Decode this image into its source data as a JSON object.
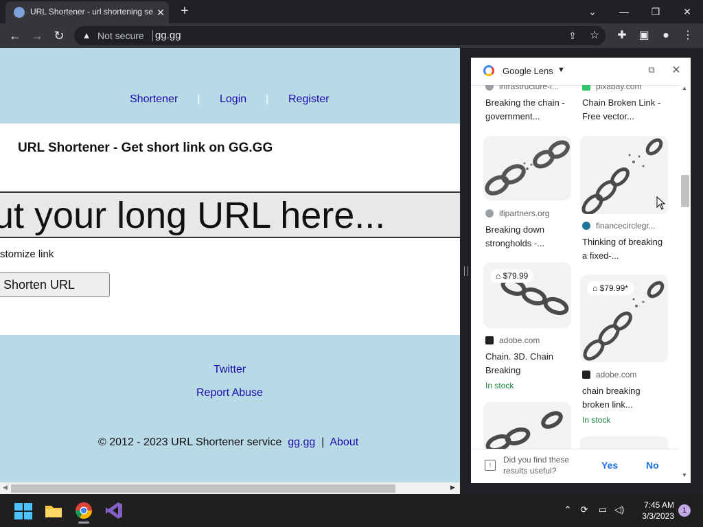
{
  "browser": {
    "tab_title": "URL Shortener - url shortening se",
    "new_tab": "+",
    "window_buttons": {
      "tab_search": "⌄",
      "minimize": "—",
      "restore": "❐",
      "close": "✕"
    },
    "security_label": "Not secure",
    "url": "gg.gg"
  },
  "page": {
    "nav": {
      "shortener": "Shortener",
      "login": "Login",
      "register": "Register",
      "sep": "|"
    },
    "title": "URL Shortener - Get short link on GG.GG",
    "url_input_placeholder": "ut your long URL here...",
    "customize": "stomize link",
    "shorten_button": "Shorten URL",
    "footer": {
      "twitter": "Twitter",
      "report": "Report Abuse",
      "copyright": "© 2012 - 2023 URL Shortener service",
      "site_link": "gg.gg",
      "sep": "|",
      "about": "About"
    }
  },
  "lens": {
    "title": "Google Lens",
    "results": [
      {
        "source": "infrastructure-i...",
        "title": "Breaking the chain - government..."
      },
      {
        "source": "pixabay.com",
        "title": "Chain Broken Link - Free vector..."
      },
      {
        "source": "ifipartners.org",
        "title": "Breaking down strongholds -..."
      },
      {
        "source": "financecirclegr...",
        "title": "Thinking of breaking a fixed-..."
      },
      {
        "source": "adobe.com",
        "title": "Chain. 3D. Chain Breaking",
        "price": "$79.99",
        "stock": "In stock"
      },
      {
        "source": "adobe.com",
        "title": "chain breaking broken link...",
        "price": "$79.99*",
        "stock": "In stock"
      }
    ],
    "feedback": {
      "question": "Did you find these results useful?",
      "yes": "Yes",
      "no": "No"
    }
  },
  "taskbar": {
    "time": "7:45 AM",
    "date": "3/3/2023",
    "notifications": "1"
  }
}
